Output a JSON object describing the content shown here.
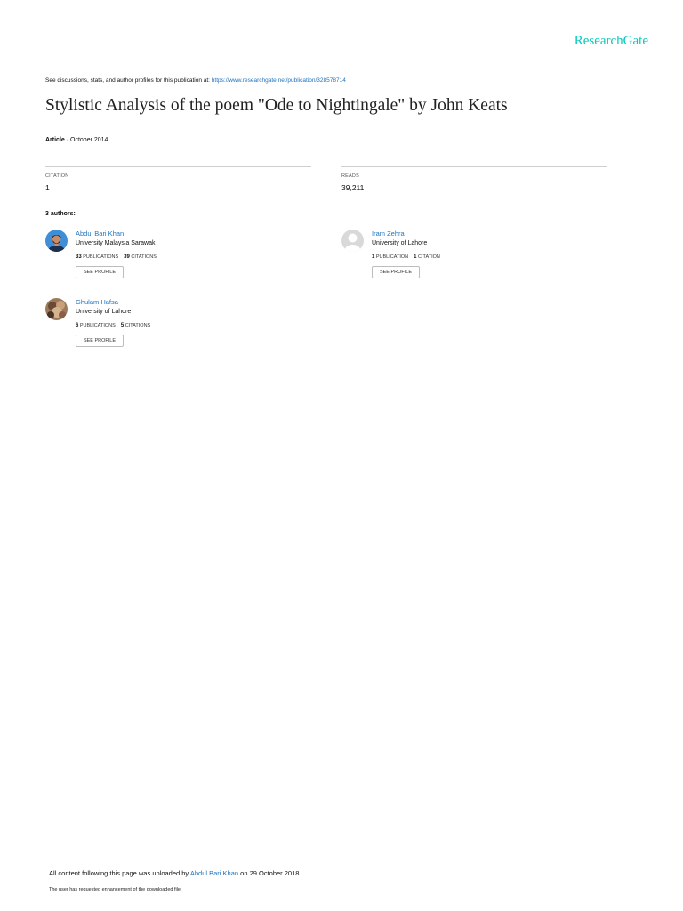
{
  "header": {
    "brand": "ResearchGate",
    "discuss_text": "See discussions, stats, and author profiles for this publication at: ",
    "discuss_link": "https://www.researchgate.net/publication/328578714"
  },
  "publication": {
    "title": "Stylistic Analysis of the poem \"Ode to Nightingale\" by John Keats",
    "type": "Article",
    "date": " · October 2014"
  },
  "stats": {
    "citation_label": "CITATION",
    "citation_value": "1",
    "reads_label": "READS",
    "reads_value": "39,211"
  },
  "authors_heading": "3 authors:",
  "authors": [
    {
      "name": "Abdul Bari Khan",
      "institution": "University Malaysia Sarawak",
      "publications": "33",
      "publications_label": "PUBLICATIONS",
      "citations": "39",
      "citations_label": "CITATIONS",
      "button": "SEE PROFILE"
    },
    {
      "name": "Iram Zehra",
      "institution": "University of Lahore",
      "publications": "1",
      "publications_label": "PUBLICATION",
      "citations": "1",
      "citations_label": "CITATION",
      "button": "SEE PROFILE"
    },
    {
      "name": "Ghulam Hafsa",
      "institution": "University of Lahore",
      "publications": "6",
      "publications_label": "PUBLICATIONS",
      "citations": "5",
      "citations_label": "CITATIONS",
      "button": "SEE PROFILE"
    }
  ],
  "footer": {
    "uploaded_prefix": "All content following this page was uploaded by ",
    "uploader": "Abdul Bari Khan",
    "uploaded_suffix": " on 29 October 2018.",
    "enhancement_note": "The user has requested enhancement of the downloaded file."
  },
  "colors": {
    "brand": "#00ccbb",
    "link": "#1e73be"
  }
}
